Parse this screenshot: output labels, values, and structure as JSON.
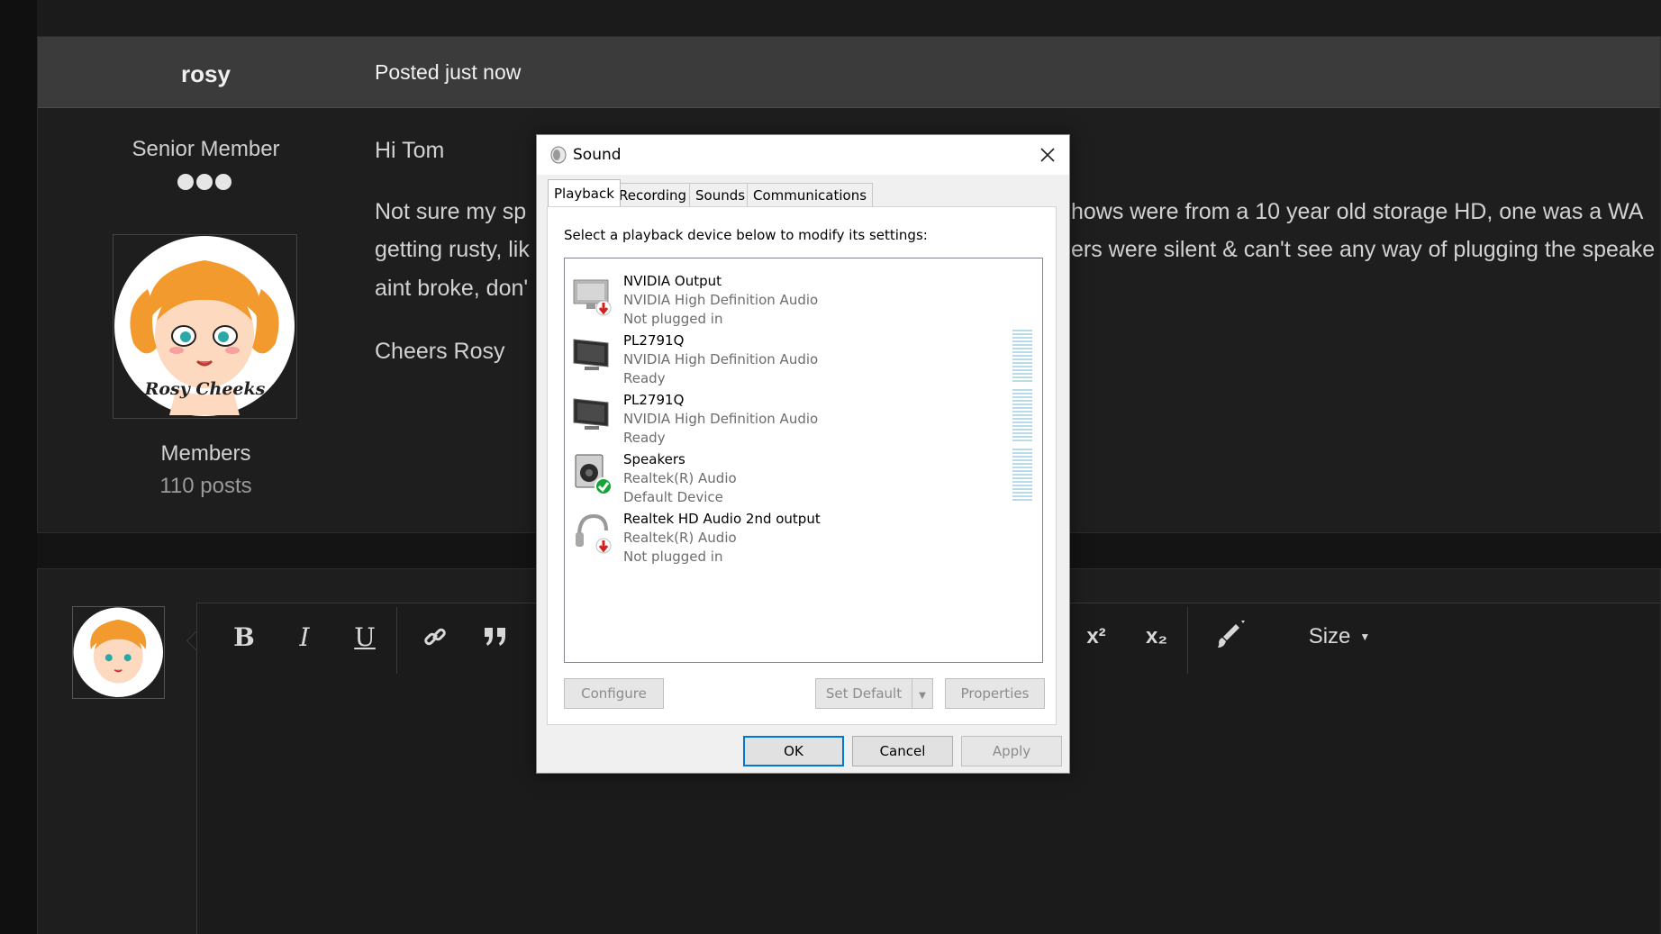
{
  "post": {
    "author": "rosy",
    "posted": "Posted just now",
    "rank": "Senior Member",
    "avatar_caption": "Rosy Cheeks",
    "group": "Members",
    "post_count": "110 posts",
    "greeting": "Hi Tom",
    "line1_left": "Not sure my sp",
    "line1_right": "hows were from a 10 year old storage HD, one was a WA",
    "line2_left": "getting rusty, lik",
    "line2_right": "ers were silent & can't see any way of plugging the speake",
    "line3_left": "aint broke, don'",
    "signoff": "Cheers Rosy"
  },
  "editor": {
    "toolbar": {
      "bold": "B",
      "italic": "I",
      "underline": "U",
      "superscript": "x²",
      "subscript": "x₂",
      "size_label": "Size"
    }
  },
  "dialog": {
    "title": "Sound",
    "tabs": [
      "Playback",
      "Recording",
      "Sounds",
      "Communications"
    ],
    "active_tab": "Playback",
    "instruction": "Select a playback device below to modify its settings:",
    "devices": [
      {
        "name": "NVIDIA Output",
        "driver": "NVIDIA High Definition Audio",
        "status": "Not plugged in",
        "icon": "monitor-unplugged-icon"
      },
      {
        "name": "PL2791Q",
        "driver": "NVIDIA High Definition Audio",
        "status": "Ready",
        "icon": "monitor-icon"
      },
      {
        "name": "PL2791Q",
        "driver": "NVIDIA High Definition Audio",
        "status": "Ready",
        "icon": "monitor-icon"
      },
      {
        "name": "Speakers",
        "driver": "Realtek(R) Audio",
        "status": "Default Device",
        "icon": "speaker-default-icon"
      },
      {
        "name": "Realtek HD Audio 2nd output",
        "driver": "Realtek(R) Audio",
        "status": "Not plugged in",
        "icon": "headphones-unplugged-icon"
      }
    ],
    "buttons": {
      "configure": "Configure",
      "set_default": "Set Default",
      "properties": "Properties",
      "ok": "OK",
      "cancel": "Cancel",
      "apply": "Apply"
    }
  },
  "colors": {
    "background": "#141414",
    "post_header": "#3b3b3b",
    "dialog_bg": "#f0f0f0",
    "accent_blue": "#0078d7",
    "default_check": "#16a53a",
    "unplugged_red": "#d21f1f"
  }
}
